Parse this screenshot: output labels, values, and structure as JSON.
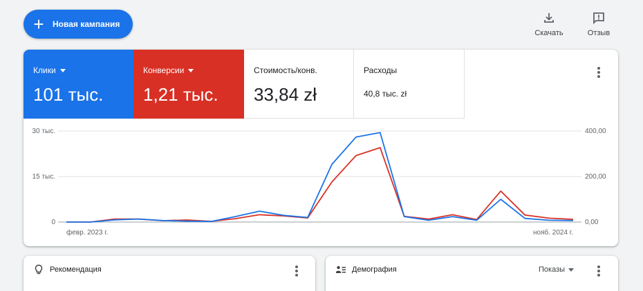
{
  "header": {
    "new_campaign_label": "Новая кампания",
    "download_label": "Скачать",
    "feedback_label": "Отзыв"
  },
  "metrics": {
    "clicks": {
      "label": "Клики",
      "value": "101 тыс.",
      "color": "#1a73e8"
    },
    "conversions": {
      "label": "Конверсии",
      "value": "1,21 тыс.",
      "color": "#d93025"
    },
    "cost_per_conv": {
      "label": "Стоимость/конв.",
      "value": "33,84 zł"
    },
    "spend": {
      "label": "Расходы",
      "value": "40,8 тыс. zł"
    }
  },
  "chart_data": {
    "type": "line",
    "x_start_label": "февр. 2023 г.",
    "x_end_label": "нояб. 2024 г.",
    "left_axis": {
      "ticks": [
        "0",
        "15 тыс.",
        "30 тыс."
      ],
      "ylim": [
        0,
        30000
      ]
    },
    "right_axis": {
      "ticks": [
        "0,00",
        "200,00",
        "400,00"
      ],
      "ylim": [
        0,
        400
      ]
    },
    "grid": true,
    "series": [
      {
        "color": "#1a73e8",
        "axis": "left",
        "values": [
          0,
          0,
          700,
          1000,
          500,
          300,
          200,
          1800,
          3600,
          2200,
          1500,
          19000,
          28000,
          29500,
          1800,
          600,
          1800,
          600,
          7500,
          1200,
          600,
          500
        ]
      },
      {
        "color": "#d93025",
        "axis": "right",
        "values": [
          0,
          0,
          13,
          13,
          6,
          9,
          3,
          15,
          32,
          27,
          18,
          176,
          292,
          327,
          25,
          13,
          32,
          11,
          136,
          31,
          17,
          12
        ]
      }
    ]
  },
  "recommendation": {
    "title": "Рекомендация"
  },
  "demographics": {
    "title": "Демография",
    "dropdown_label": "Показы"
  }
}
